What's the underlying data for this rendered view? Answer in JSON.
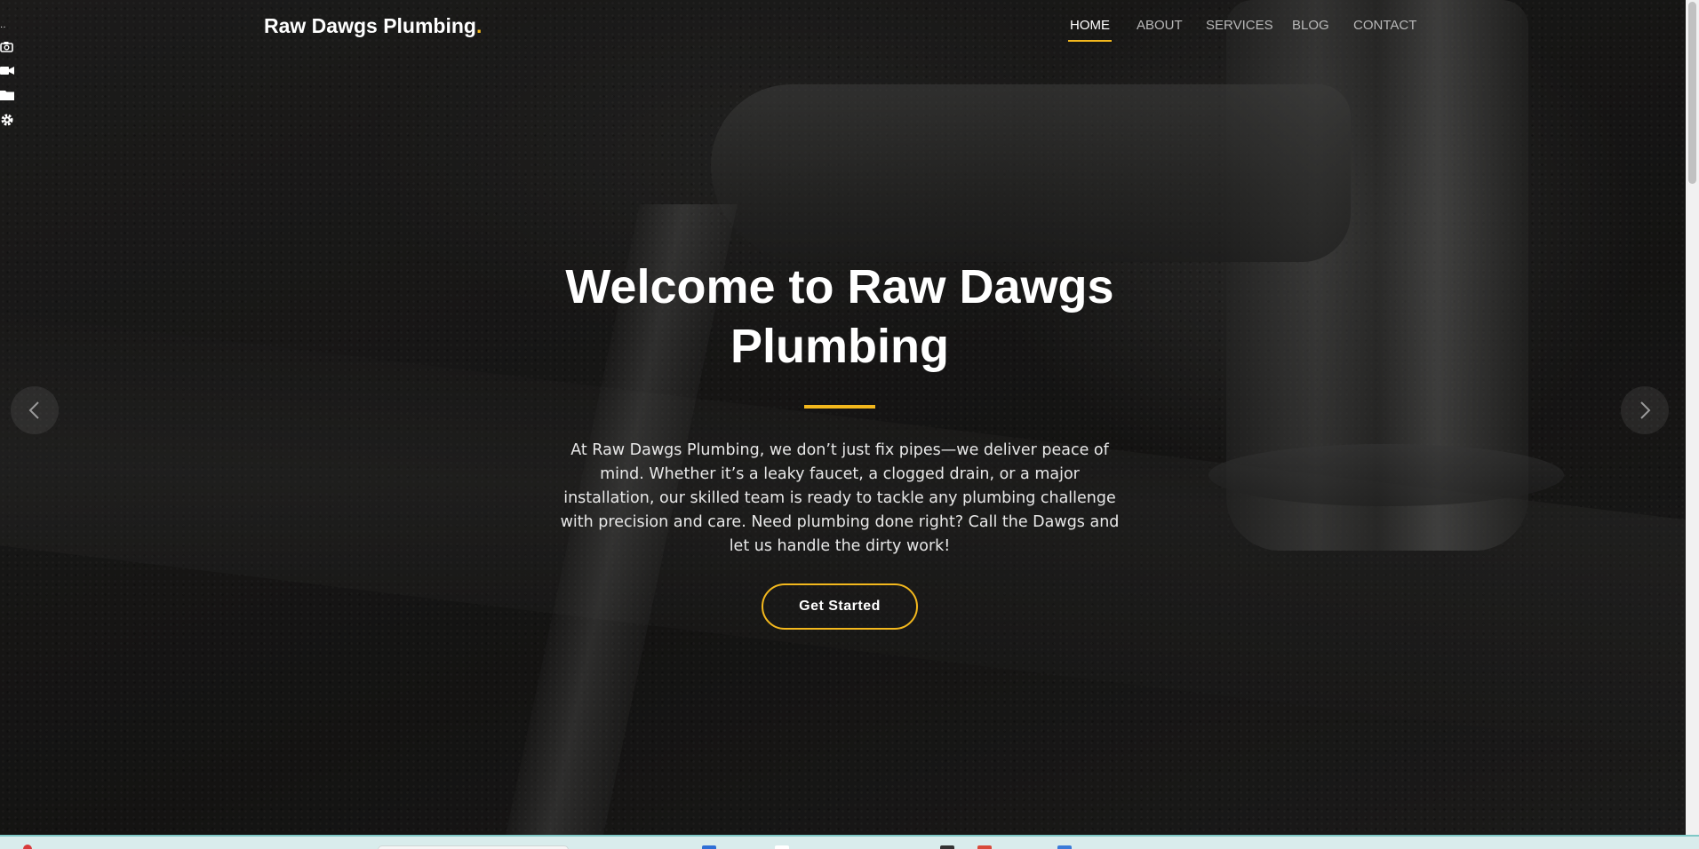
{
  "brand": {
    "name": "Raw Dawgs Plumbing",
    "dot": ".",
    "accent_color": "#f3b81d"
  },
  "nav": {
    "items": [
      {
        "label": "HOME",
        "active": true
      },
      {
        "label": "ABOUT",
        "active": false
      },
      {
        "label": "SERVICES",
        "active": false
      },
      {
        "label": "BLOG",
        "active": false
      },
      {
        "label": "CONTACT",
        "active": false
      }
    ]
  },
  "hero": {
    "title_line1": "Welcome to Raw Dawgs",
    "title_line2": "Plumbing",
    "text": "At Raw Dawgs Plumbing, we don’t just fix pipes—we deliver peace of mind. Whether it’s a leaky faucet, a clogged drain, or a major installation, our skilled team is ready to tackle any plumbing challenge with precision and care. Need plumbing done right? Call the Dawgs and let us handle the dirty work!",
    "cta_label": "Get Started"
  },
  "carousel": {
    "prev_icon": "chevron-left-icon",
    "next_icon": "chevron-right-icon"
  },
  "tool_strip": {
    "icons": [
      "camera-icon",
      "video-icon",
      "folder-icon",
      "gear-icon"
    ]
  }
}
